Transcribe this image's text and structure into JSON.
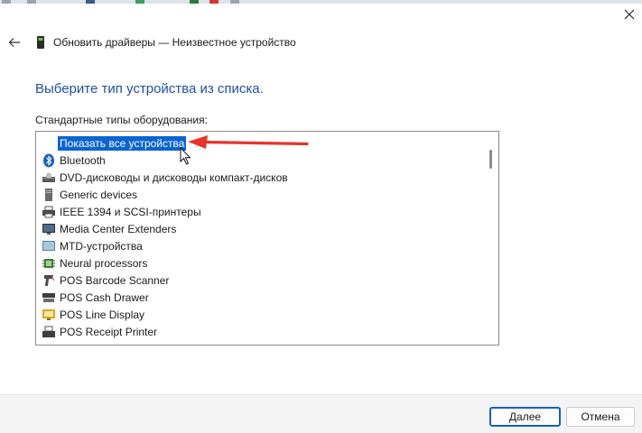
{
  "window": {
    "title": "Обновить драйверы — Неизвестное устройство",
    "close_glyph": "✕",
    "back_glyph": "←"
  },
  "content": {
    "heading": "Выберите тип устройства из списка.",
    "list_label": "Стандартные типы оборудования:"
  },
  "device_list": [
    {
      "label": "Показать все устройства",
      "icon": "none",
      "selected": true
    },
    {
      "label": "Bluetooth",
      "icon": "bluetooth-icon",
      "selected": false
    },
    {
      "label": "DVD-дисководы и дисководы компакт-дисков",
      "icon": "dvd-drive-icon",
      "selected": false
    },
    {
      "label": "Generic devices",
      "icon": "generic-device-icon",
      "selected": false
    },
    {
      "label": "IEEE 1394 и SCSI-принтеры",
      "icon": "printer-icon",
      "selected": false
    },
    {
      "label": "Media Center Extenders",
      "icon": "monitor-icon",
      "selected": false
    },
    {
      "label": "MTD-устройства",
      "icon": "mtd-device-icon",
      "selected": false
    },
    {
      "label": "Neural processors",
      "icon": "chip-icon",
      "selected": false
    },
    {
      "label": "POS Barcode Scanner",
      "icon": "barcode-scanner-icon",
      "selected": false
    },
    {
      "label": "POS Cash Drawer",
      "icon": "cash-drawer-icon",
      "selected": false
    },
    {
      "label": "POS Line Display",
      "icon": "line-display-icon",
      "selected": false
    },
    {
      "label": "POS Receipt Printer",
      "icon": "receipt-printer-icon",
      "selected": false
    }
  ],
  "buttons": {
    "next": "Далее",
    "cancel": "Отмена"
  },
  "colors": {
    "heading": "#1f4fa8",
    "selection": "#0a64d2",
    "annotation_arrow": "#e8352a",
    "primary_border": "#1060c8"
  }
}
